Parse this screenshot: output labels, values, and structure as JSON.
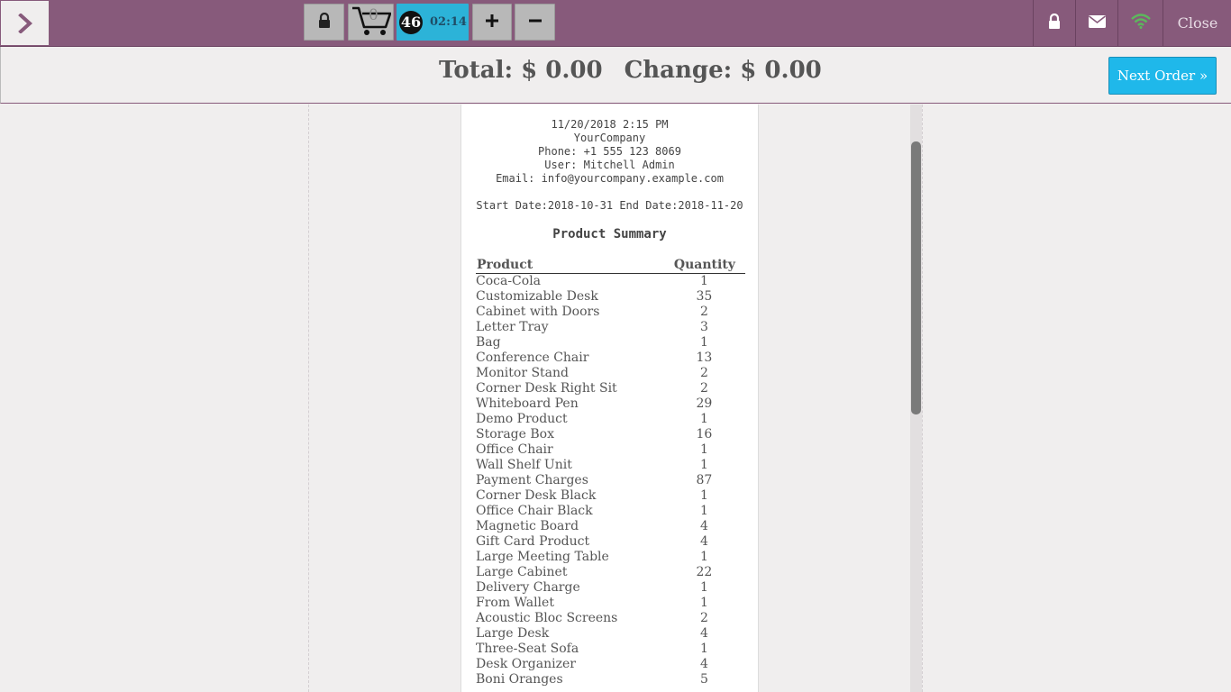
{
  "topbar": {
    "cart_count": "0",
    "order_number": "46",
    "order_time": "02:14",
    "plus_label": "+",
    "minus_label": "−",
    "close_label": "Close",
    "accent": "#875a7b",
    "order_color": "#2cb3d8",
    "wifi_color": "#5cb85c"
  },
  "summary": {
    "total": "Total: $ 0.00",
    "change": "Change: $ 0.00",
    "next_order": "Next Order »"
  },
  "receipt": {
    "datetime": "11/20/2018 2:15 PM",
    "company": "YourCompany",
    "phone": "Phone: +1 555 123 8069",
    "user": "User: Mitchell Admin",
    "email": "Email: info@yourcompany.example.com",
    "dates": "Start Date:2018-10-31 End Date:2018-11-20",
    "title": "Product Summary",
    "col_product": "Product",
    "col_quantity": "Quantity",
    "rows": [
      {
        "product": "Coca-Cola",
        "qty": "1"
      },
      {
        "product": "Customizable Desk",
        "qty": "35"
      },
      {
        "product": "Cabinet with Doors",
        "qty": "2"
      },
      {
        "product": "Letter Tray",
        "qty": "3"
      },
      {
        "product": "Bag",
        "qty": "1"
      },
      {
        "product": "Conference Chair",
        "qty": "13"
      },
      {
        "product": "Monitor Stand",
        "qty": "2"
      },
      {
        "product": "Corner Desk Right Sit",
        "qty": "2"
      },
      {
        "product": "Whiteboard Pen",
        "qty": "29"
      },
      {
        "product": "Demo Product",
        "qty": "1"
      },
      {
        "product": "Storage Box",
        "qty": "16"
      },
      {
        "product": "Office Chair",
        "qty": "1"
      },
      {
        "product": "Wall Shelf Unit",
        "qty": "1"
      },
      {
        "product": "Payment Charges",
        "qty": "87"
      },
      {
        "product": "Corner Desk Black",
        "qty": "1"
      },
      {
        "product": "Office Chair Black",
        "qty": "1"
      },
      {
        "product": "Magnetic Board",
        "qty": "4"
      },
      {
        "product": "Gift Card Product",
        "qty": "4"
      },
      {
        "product": "Large Meeting Table",
        "qty": "1"
      },
      {
        "product": "Large Cabinet",
        "qty": "22"
      },
      {
        "product": "Delivery Charge",
        "qty": "1"
      },
      {
        "product": "From Wallet",
        "qty": "1"
      },
      {
        "product": "Acoustic Bloc Screens",
        "qty": "2"
      },
      {
        "product": "Large Desk",
        "qty": "4"
      },
      {
        "product": "Three-Seat Sofa",
        "qty": "1"
      },
      {
        "product": "Desk Organizer",
        "qty": "4"
      },
      {
        "product": "Boni Oranges",
        "qty": "5"
      }
    ]
  }
}
